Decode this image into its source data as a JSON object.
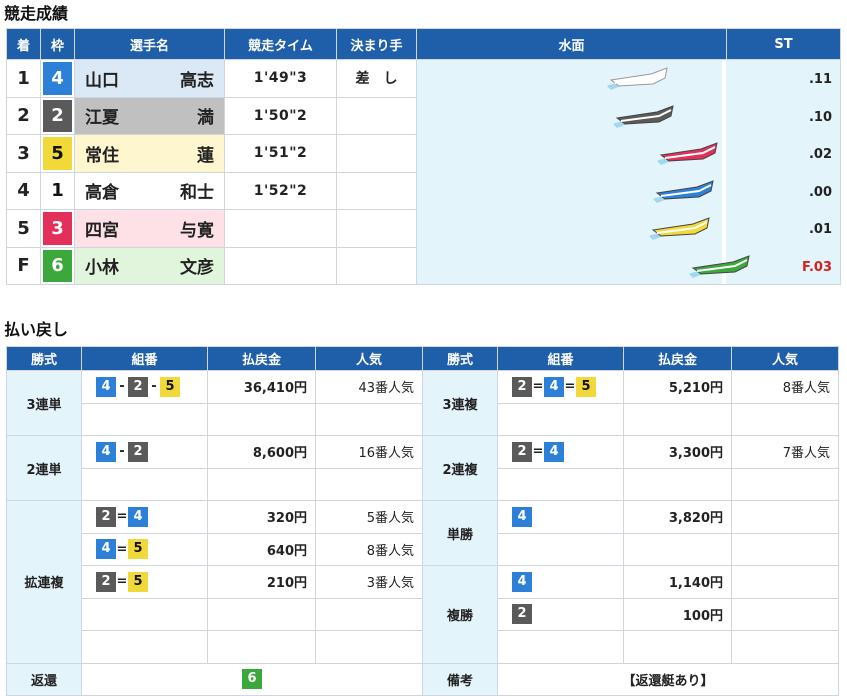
{
  "results_title": "競走成績",
  "payout_title": "払い戻し",
  "results_headers": {
    "rank": "着",
    "waku": "枠",
    "racer": "選手名",
    "time": "競走タイム",
    "kimarite": "決まり手",
    "water": "水面",
    "st": "ST"
  },
  "waku_colors": {
    "1": {
      "bg": "#ffffff",
      "fg": "#111111",
      "row": "#ffffff"
    },
    "2": {
      "bg": "#5a5a5a",
      "fg": "#ffffff",
      "row": "#c0c0c0"
    },
    "3": {
      "bg": "#e2305a",
      "fg": "#ffffff",
      "row": "#fde1e6"
    },
    "4": {
      "bg": "#2d80d7",
      "fg": "#ffffff",
      "row": "#dbe9f7"
    },
    "5": {
      "bg": "#f2d93a",
      "fg": "#111111",
      "row": "#fdf6cf"
    },
    "6": {
      "bg": "#3aa83a",
      "fg": "#ffffff",
      "row": "#e1f5dc"
    }
  },
  "results": [
    {
      "rank": "1",
      "waku": "4",
      "surname": "山口",
      "given": "高志",
      "time": "1'49\"3",
      "kimarite": "差　し"
    },
    {
      "rank": "2",
      "waku": "2",
      "surname": "江夏",
      "given": "満",
      "time": "1'50\"2",
      "kimarite": ""
    },
    {
      "rank": "3",
      "waku": "5",
      "surname": "常住",
      "given": "蓮",
      "time": "1'51\"2",
      "kimarite": ""
    },
    {
      "rank": "4",
      "waku": "1",
      "surname": "高倉",
      "given": "和士",
      "time": "1'52\"2",
      "kimarite": ""
    },
    {
      "rank": "5",
      "waku": "3",
      "surname": "四宮",
      "given": "与寛",
      "time": "",
      "kimarite": ""
    },
    {
      "rank": "F",
      "waku": "6",
      "surname": "小林",
      "given": "文彦",
      "time": "",
      "kimarite": ""
    }
  ],
  "start_timing": [
    {
      "course": 1,
      "boat": "1",
      "st": ".11",
      "flying": false
    },
    {
      "course": 2,
      "boat": "2",
      "st": ".10",
      "flying": false
    },
    {
      "course": 3,
      "boat": "3",
      "st": ".02",
      "flying": false
    },
    {
      "course": 4,
      "boat": "4",
      "st": ".00",
      "flying": false
    },
    {
      "course": 5,
      "boat": "5",
      "st": ".01",
      "flying": false
    },
    {
      "course": 6,
      "boat": "6",
      "st": "F.03",
      "flying": true
    }
  ],
  "payout_headers": {
    "type": "勝式",
    "combo": "組番",
    "amount": "払戻金",
    "popularity": "人気"
  },
  "payouts": {
    "trifecta": {
      "label": "3連単",
      "combo": [
        "4",
        "2",
        "5"
      ],
      "sep": "-",
      "amount": "36,410円",
      "popularity": "43番人気"
    },
    "trio": {
      "label": "3連複",
      "combo": [
        "2",
        "4",
        "5"
      ],
      "sep": "=",
      "amount": "5,210円",
      "popularity": "8番人気"
    },
    "exacta": {
      "label": "2連単",
      "combo": [
        "4",
        "2"
      ],
      "sep": "-",
      "amount": "8,600円",
      "popularity": "16番人気"
    },
    "quinella": {
      "label": "2連複",
      "combo": [
        "2",
        "4"
      ],
      "sep": "=",
      "amount": "3,300円",
      "popularity": "7番人気"
    },
    "wide_label": "拡連複",
    "wide": [
      {
        "combo": [
          "2",
          "4"
        ],
        "sep": "=",
        "amount": "320円",
        "popularity": "5番人気"
      },
      {
        "combo": [
          "4",
          "5"
        ],
        "sep": "=",
        "amount": "640円",
        "popularity": "8番人気"
      },
      {
        "combo": [
          "2",
          "5"
        ],
        "sep": "=",
        "amount": "210円",
        "popularity": "3番人気"
      }
    ],
    "win": {
      "label": "単勝",
      "combo": [
        "4"
      ],
      "amount": "3,820円",
      "popularity": ""
    },
    "place_label": "複勝",
    "place": [
      {
        "combo": [
          "4"
        ],
        "amount": "1,140円"
      },
      {
        "combo": [
          "2"
        ],
        "amount": "100円"
      }
    ],
    "refund_label": "返還",
    "refund_boat": "6",
    "note_label": "備考",
    "note": "【返還艇あり】"
  }
}
